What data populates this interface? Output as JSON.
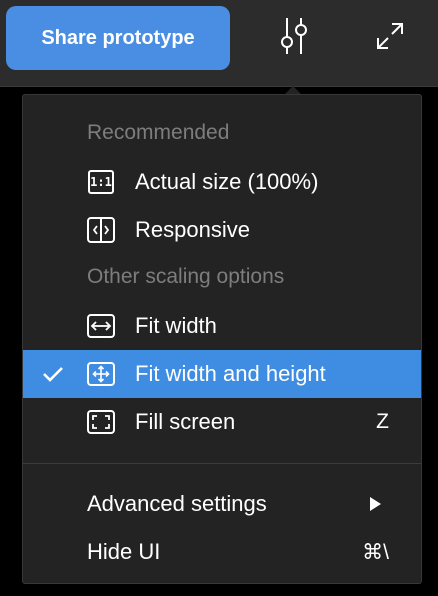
{
  "toolbar": {
    "share_label": "Share prototype",
    "settings_icon": "sliders-icon",
    "expand_icon": "expand-icon"
  },
  "menu": {
    "section_recommended": "Recommended",
    "section_other": "Other scaling options",
    "items": [
      {
        "label": "Actual size (100%)",
        "icon": "one-to-one-icon",
        "selected": false
      },
      {
        "label": "Responsive",
        "icon": "responsive-icon",
        "selected": false
      },
      {
        "label": "Fit width",
        "icon": "fit-width-icon",
        "selected": false
      },
      {
        "label": "Fit width and height",
        "icon": "fit-width-height-icon",
        "selected": true
      },
      {
        "label": "Fill screen",
        "icon": "fill-screen-icon",
        "shortcut": "Z",
        "selected": false
      }
    ],
    "advanced_label": "Advanced settings",
    "hide_ui_label": "Hide UI",
    "hide_ui_shortcut": "⌘\\",
    "one_to_one_glyph": "1:1"
  },
  "colors": {
    "accent": "#3f8de3",
    "share_button": "#4a8ee4",
    "menu_bg": "#232323",
    "toolbar_bg": "#2c2c2c",
    "section_text": "#7d7d7d"
  }
}
